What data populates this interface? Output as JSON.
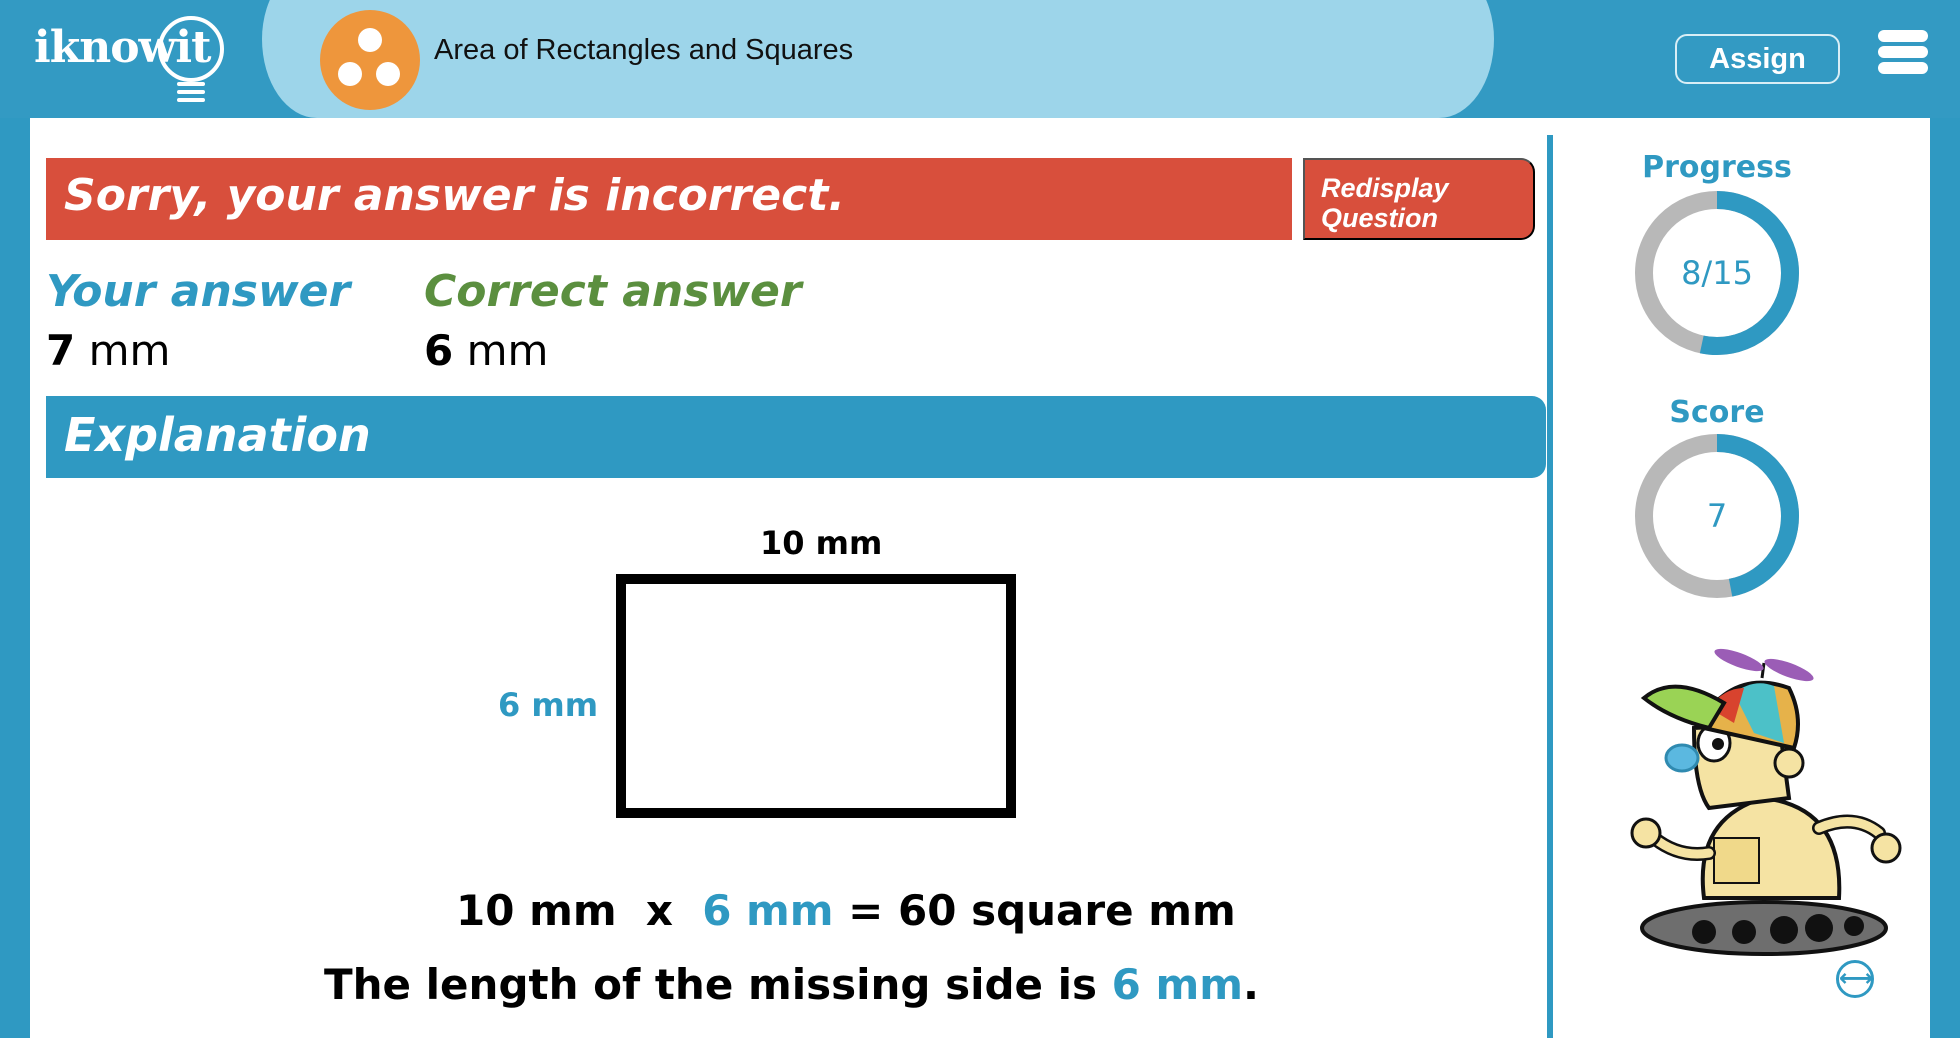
{
  "header": {
    "logo_text": "iknowit",
    "topic_title": "Area of Rectangles and Squares",
    "assign_label": "Assign",
    "menu_icon": "hamburger-menu-icon",
    "colors": {
      "header_bg": "#339ac3",
      "title_pill": "#9dd5ea",
      "topic_icon": "#ee963c"
    }
  },
  "feedback": {
    "message": "Sorry, your answer is incorrect.",
    "redisplay_line1": "Redisplay",
    "redisplay_line2": "Question",
    "color": "#d84f3c"
  },
  "answers": {
    "your_label": "Your answer",
    "your_value": "7",
    "your_unit": " mm",
    "correct_label": "Correct answer",
    "correct_value": "6",
    "correct_unit": " mm"
  },
  "explanation": {
    "heading": "Explanation",
    "diagram": {
      "top_label": "10 mm",
      "side_label": "6 mm"
    },
    "equation": {
      "part1": "10 mm  x  ",
      "highlight": "6 mm",
      "part2": " = 60 square mm"
    },
    "conclusion": {
      "part1": "The length of the missing side is ",
      "highlight": "6 mm",
      "part2": "."
    }
  },
  "sidebar": {
    "progress": {
      "label": "Progress",
      "value_text": "8/15",
      "current": 8,
      "total": 15
    },
    "score": {
      "label": "Score",
      "value_text": "7",
      "fraction": 0.47
    },
    "mascot": "robot-mascot",
    "swap_icon": "swap-arrows-icon"
  }
}
